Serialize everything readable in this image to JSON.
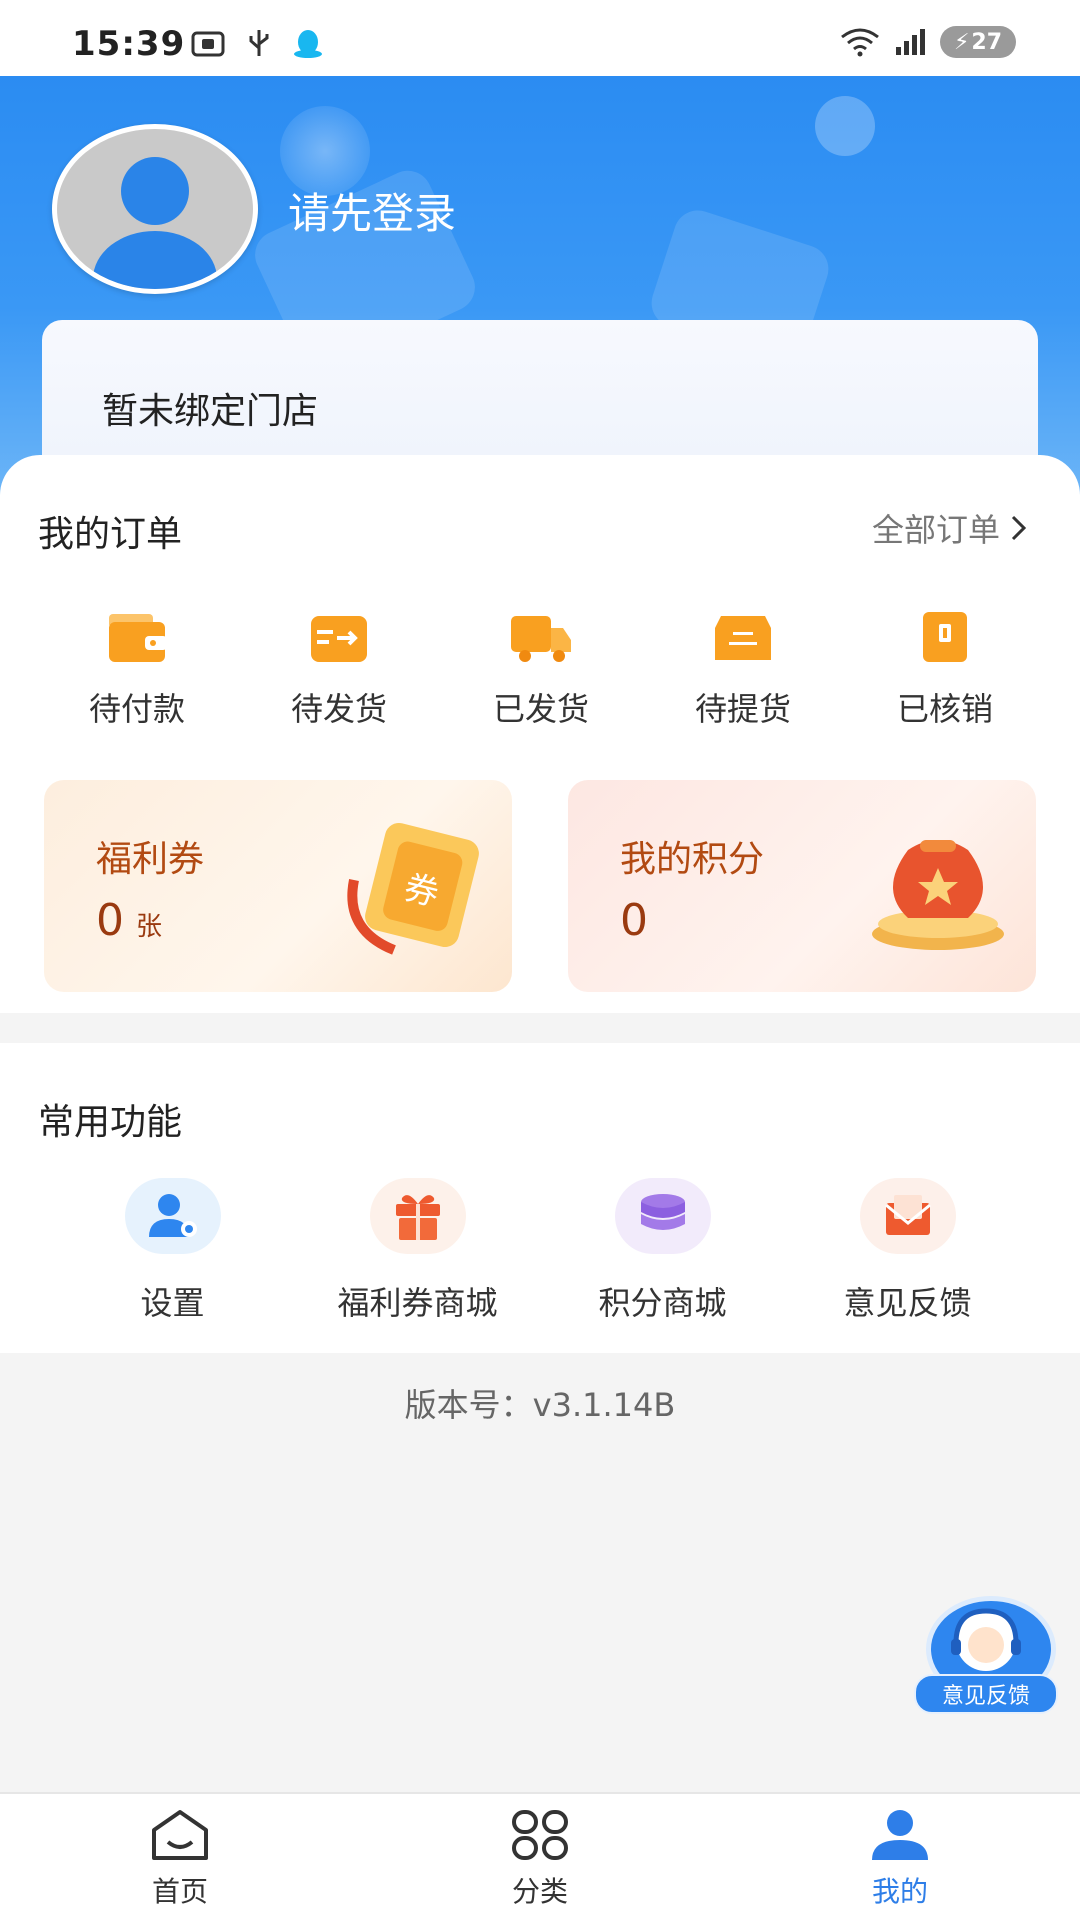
{
  "status_bar": {
    "time": "15:39",
    "battery": "27"
  },
  "profile": {
    "login_prompt": "请先登录",
    "store_status": "暂未绑定门店"
  },
  "orders": {
    "title": "我的订单",
    "all_link": "全部订单",
    "items": [
      {
        "label": "待付款",
        "icon": "wallet-icon"
      },
      {
        "label": "待发货",
        "icon": "shipping-box-icon"
      },
      {
        "label": "已发货",
        "icon": "truck-icon"
      },
      {
        "label": "待提货",
        "icon": "pickup-box-icon"
      },
      {
        "label": "已核销",
        "icon": "verified-doc-icon"
      }
    ]
  },
  "promos": {
    "coupon": {
      "title": "福利券",
      "value": "0",
      "unit": "张",
      "art": "券"
    },
    "points": {
      "title": "我的积分",
      "value": "0"
    }
  },
  "functions": {
    "title": "常用功能",
    "items": [
      {
        "label": "设置",
        "icon": "user-settings-icon",
        "bg": "#e6f2fd"
      },
      {
        "label": "福利券商城",
        "icon": "gift-icon",
        "bg": "#fdf1ea"
      },
      {
        "label": "积分商城",
        "icon": "coins-stack-icon",
        "bg": "#f2ebfb"
      },
      {
        "label": "意见反馈",
        "icon": "mail-icon",
        "bg": "#fdf0ea"
      }
    ]
  },
  "version_text": "版本号：v3.1.14B",
  "floating_feedback": {
    "label": "意见反馈"
  },
  "tabbar": [
    {
      "label": "首页",
      "icon": "home-icon",
      "active": false
    },
    {
      "label": "分类",
      "icon": "category-icon",
      "active": false
    },
    {
      "label": "我的",
      "icon": "profile-icon",
      "active": true
    }
  ],
  "colors": {
    "primary": "#2b8cf2",
    "accent_orange": "#f9a020",
    "promo_text": "#b24a12"
  }
}
